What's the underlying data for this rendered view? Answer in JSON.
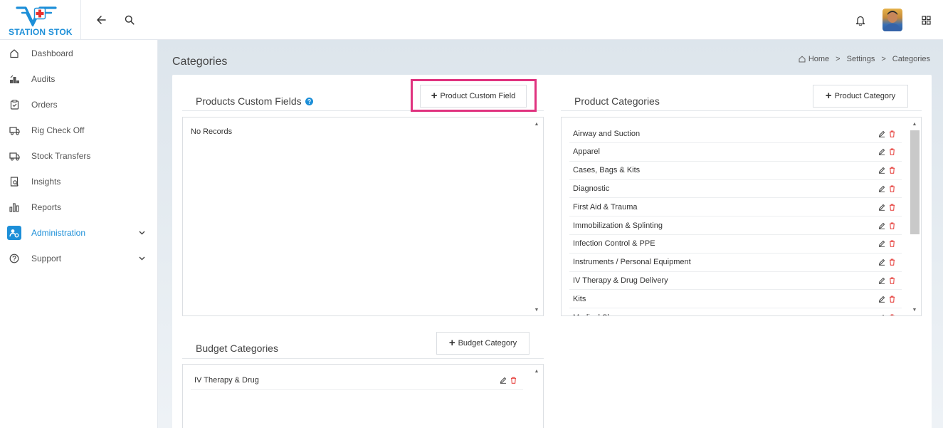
{
  "app": {
    "logo_text": "STATION STOK"
  },
  "sidebar": {
    "items": [
      {
        "label": "Dashboard",
        "icon": "home-icon"
      },
      {
        "label": "Audits",
        "icon": "audits-icon"
      },
      {
        "label": "Orders",
        "icon": "clipboard-icon"
      },
      {
        "label": "Rig Check Off",
        "icon": "truck-icon"
      },
      {
        "label": "Stock Transfers",
        "icon": "truck-icon"
      },
      {
        "label": "Insights",
        "icon": "insights-icon"
      },
      {
        "label": "Reports",
        "icon": "bar-chart-icon"
      },
      {
        "label": "Administration",
        "icon": "admin-icon",
        "active": true
      },
      {
        "label": "Support",
        "icon": "help-circle-icon"
      }
    ]
  },
  "page": {
    "title": "Categories",
    "breadcrumb": [
      "Home",
      "Settings",
      "Categories"
    ],
    "breadcrumb_sep": ">"
  },
  "custom_fields": {
    "title": "Products Custom Fields",
    "add_label": "Product Custom Field",
    "empty_text": "No Records"
  },
  "product_categories": {
    "title": "Product Categories",
    "add_label": "Product Category",
    "items": [
      "Airway and Suction",
      "Apparel",
      "Cases, Bags & Kits",
      "Diagnostic",
      "First Aid & Trauma",
      "Immobilization & Splinting",
      "Infection Control & PPE",
      "Instruments / Personal Equipment",
      "IV Therapy & Drug Delivery",
      "Kits",
      "Medical Sharps"
    ]
  },
  "budget_categories": {
    "title": "Budget Categories",
    "add_label": "Budget Category",
    "items": [
      "IV Therapy & Drug"
    ]
  },
  "colors": {
    "accent": "#1d8fd8",
    "highlight": "#e0337f",
    "delete": "#e53935",
    "logo_red": "#e8312f"
  }
}
